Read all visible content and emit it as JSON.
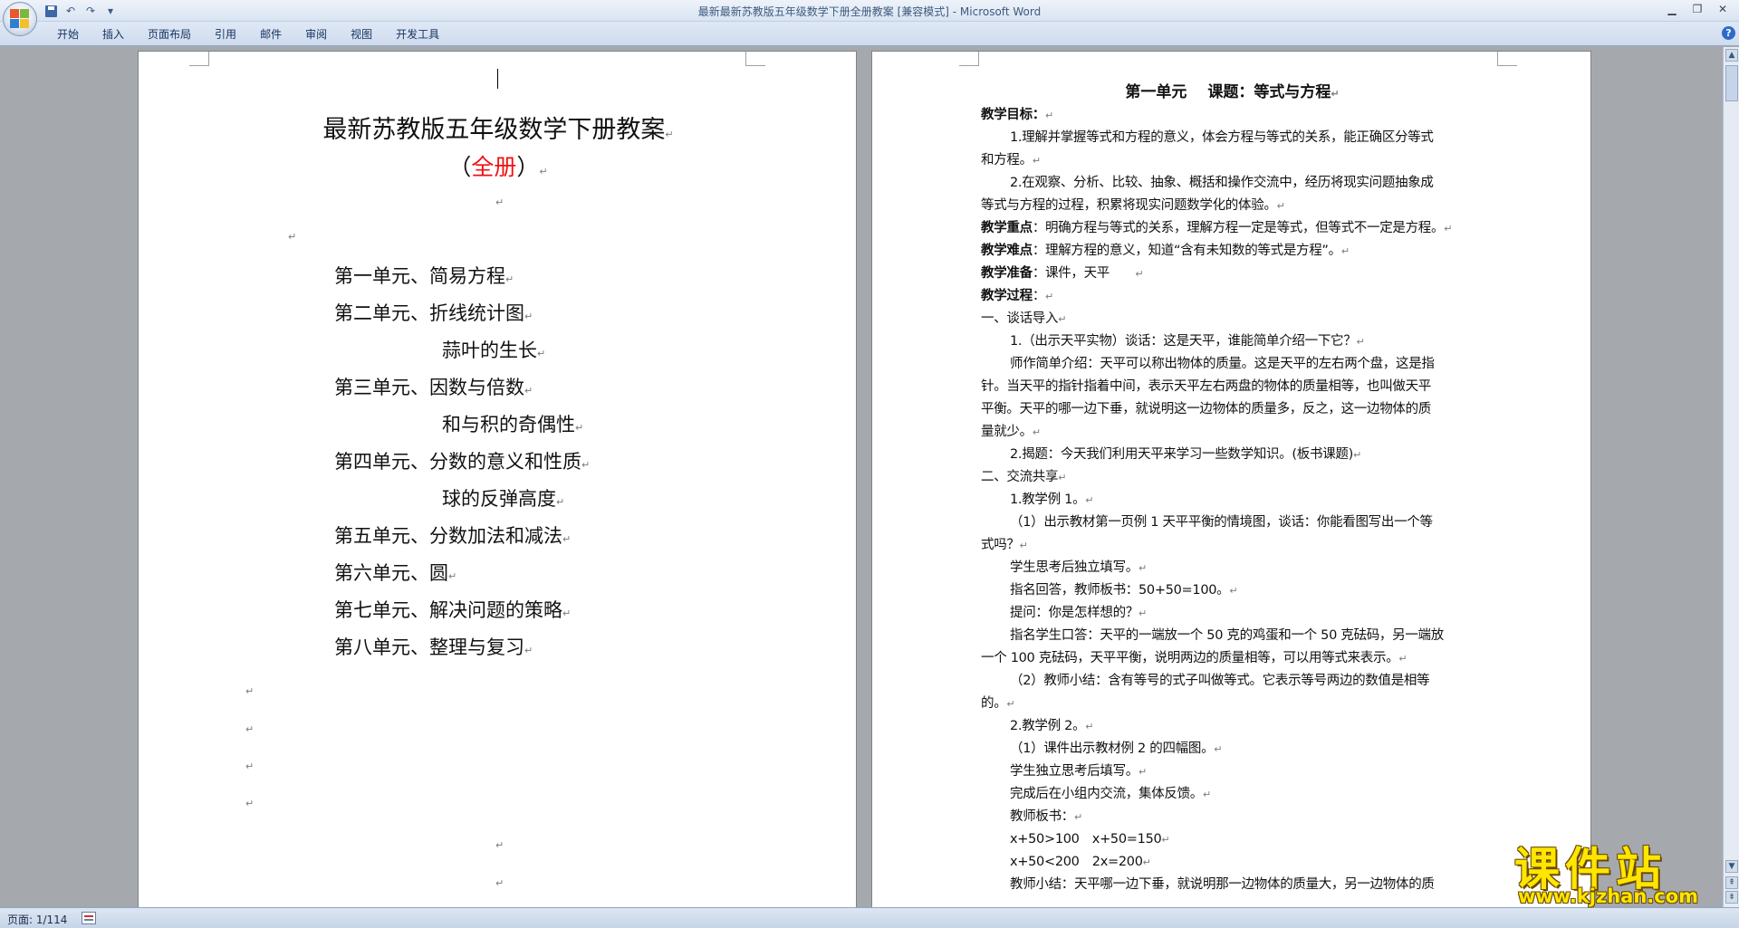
{
  "window": {
    "title": "最新最新苏教版五年级数学下册全册教案 [兼容模式] - Microsoft Word"
  },
  "qat": {
    "undo": "↶",
    "redo": "↷",
    "customize": "▾"
  },
  "ribbon": {
    "tabs": [
      "开始",
      "插入",
      "页面布局",
      "引用",
      "邮件",
      "审阅",
      "视图",
      "开发工具"
    ],
    "help": "?"
  },
  "page1": {
    "title": "最新苏教版五年级数学下册教案",
    "subtitle_open": "（",
    "subtitle_red": "全册",
    "subtitle_close": "）",
    "paragraph_mark": "↵",
    "toc": [
      "第一单元、简易方程",
      "第二单元、折线统计图",
      "蒜叶的生长",
      "第三单元、因数与倍数",
      "和与积的奇偶性",
      "第四单元、分数的意义和性质",
      "球的反弹高度",
      "第五单元、分数加法和减法",
      "第六单元、圆",
      "第七单元、解决问题的策略",
      "第八单元、整理与复习"
    ]
  },
  "page2": {
    "title": "第一单元　 课题：等式与方程",
    "goal_label": "教学目标：",
    "goal_1a": "1.理解并掌握等式和方程的意义，体会方程与等式的关系，能正确区分等式",
    "goal_1b": "和方程。",
    "goal_2a": "2.在观察、分析、比较、抽象、概括和操作交流中，经历将现实问题抽象成",
    "goal_2b": "等式与方程的过程，积累将现实问题数学化的体验。",
    "key_label": "教学重点",
    "key_text": "：明确方程与等式的关系，理解方程一定是等式，但等式不一定是方程。",
    "diff_label": "教学难点",
    "diff_text": "：理解方程的意义，知道“含有未知数的等式是方程”。",
    "prep_label": "教学准备",
    "prep_text": "：课件，天平",
    "process_label": "教学过程",
    "process_colon": "：",
    "s1": "一、谈话导入",
    "s1_1": "1.（出示天平实物）谈话：这是天平，谁能简单介绍一下它？",
    "s1_2a": "师作简单介绍：天平可以称出物体的质量。这是天平的左右两个盘，这是指",
    "s1_2b": "针。当天平的指针指着中间，表示天平左右两盘的物体的质量相等，也叫做天平",
    "s1_2c": "平衡。天平的哪一边下垂，就说明这一边物体的质量多，反之，这一边物体的质",
    "s1_2d": "量就少。",
    "s1_3": "2.揭题：今天我们利用天平来学习一些数学知识。(板书课题)",
    "s2": "二、交流共享",
    "ex1": "1.教学例 1。",
    "ex1_1a": "（1）出示教材第一页例 1 天平平衡的情境图，谈话：你能看图写出一个等",
    "ex1_1b": "式吗？",
    "ex1_2": "学生思考后独立填写。",
    "ex1_3": "指名回答，教师板书：50+50=100。",
    "ex1_4": "提问：你是怎样想的？",
    "ex1_5a": "指名学生口答：天平的一端放一个 50 克的鸡蛋和一个 50 克砝码，另一端放",
    "ex1_5b": "一个 100 克砝码，天平平衡，说明两边的质量相等，可以用等式来表示。",
    "ex1_6a": "（2）教师小结：含有等号的式子叫做等式。它表示等号两边的数值是相等",
    "ex1_6b": "的。",
    "ex2": "2.教学例 2。",
    "ex2_1": "（1）课件出示教材例 2 的四幅图。",
    "ex2_2": "学生独立思考后填写。",
    "ex2_3": "完成后在小组内交流，集体反馈。",
    "ex2_4": "教师板书：",
    "ex2_5": "x+50>100　x+50=150",
    "ex2_6": "x+50<200　2x=200",
    "ex2_7": "教师小结：天平哪一边下垂，就说明那一边物体的质量大，另一边物体的质"
  },
  "status": {
    "page": "页面: 1/114"
  },
  "watermark": {
    "cn": "课件站",
    "url": "www.kjzhan.com"
  }
}
